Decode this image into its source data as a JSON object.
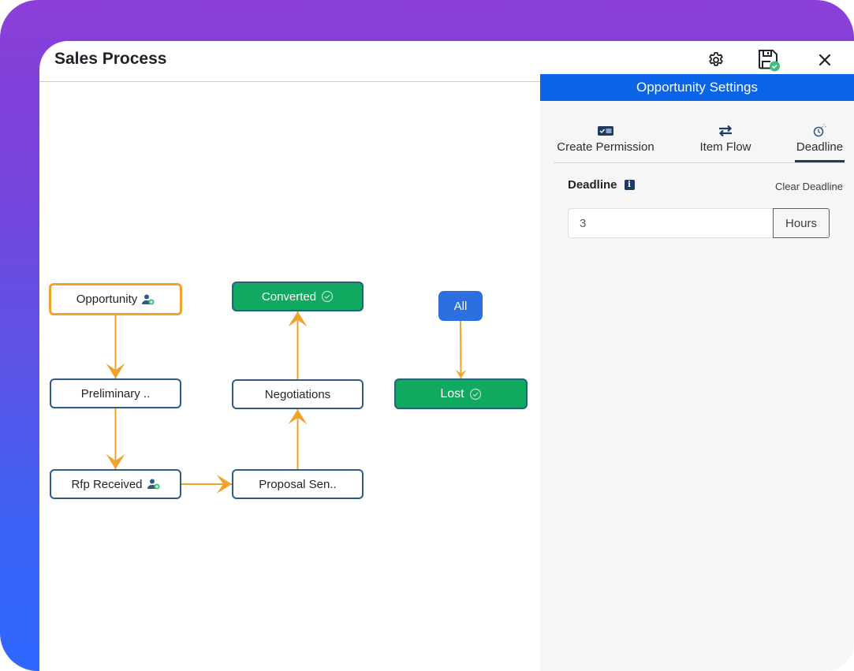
{
  "window": {
    "title": "Sales Process",
    "actions": {
      "settings": "gear-icon",
      "save": "save-icon",
      "close": "close-icon"
    }
  },
  "panel": {
    "title": "Opportunity Settings",
    "tabs": [
      {
        "label": "Create Permission",
        "icon": "permission-icon",
        "active": false
      },
      {
        "label": "Item Flow",
        "icon": "flow-icon",
        "active": false
      },
      {
        "label": "Deadline",
        "icon": "deadline-icon",
        "active": true
      }
    ],
    "deadline": {
      "label": "Deadline",
      "clear_label": "Clear Deadline",
      "value": "3",
      "unit": "Hours"
    }
  },
  "flow": {
    "nodes": [
      {
        "id": "opportunity",
        "label": "Opportunity",
        "kind": "start",
        "icon": "user-add-icon"
      },
      {
        "id": "preliminary",
        "label": "Preliminary ..",
        "kind": "plain"
      },
      {
        "id": "rfp",
        "label": "Rfp Received",
        "kind": "plain",
        "icon": "user-add-icon"
      },
      {
        "id": "proposal",
        "label": "Proposal Sen..",
        "kind": "plain"
      },
      {
        "id": "negotiations",
        "label": "Negotiations",
        "kind": "plain"
      },
      {
        "id": "converted",
        "label": "Converted",
        "kind": "done",
        "icon": "check-circle-icon"
      },
      {
        "id": "all",
        "label": "All",
        "kind": "all"
      },
      {
        "id": "lost",
        "label": "Lost",
        "kind": "done",
        "icon": "check-circle-icon"
      }
    ],
    "edges": [
      [
        "opportunity",
        "preliminary"
      ],
      [
        "preliminary",
        "rfp"
      ],
      [
        "rfp",
        "proposal"
      ],
      [
        "proposal",
        "negotiations"
      ],
      [
        "negotiations",
        "converted"
      ],
      [
        "all",
        "lost"
      ]
    ],
    "colors": {
      "edge": "#f0a32a",
      "done": "#10a95f",
      "all": "#2e6fe0",
      "border": "#2f5b86"
    }
  }
}
